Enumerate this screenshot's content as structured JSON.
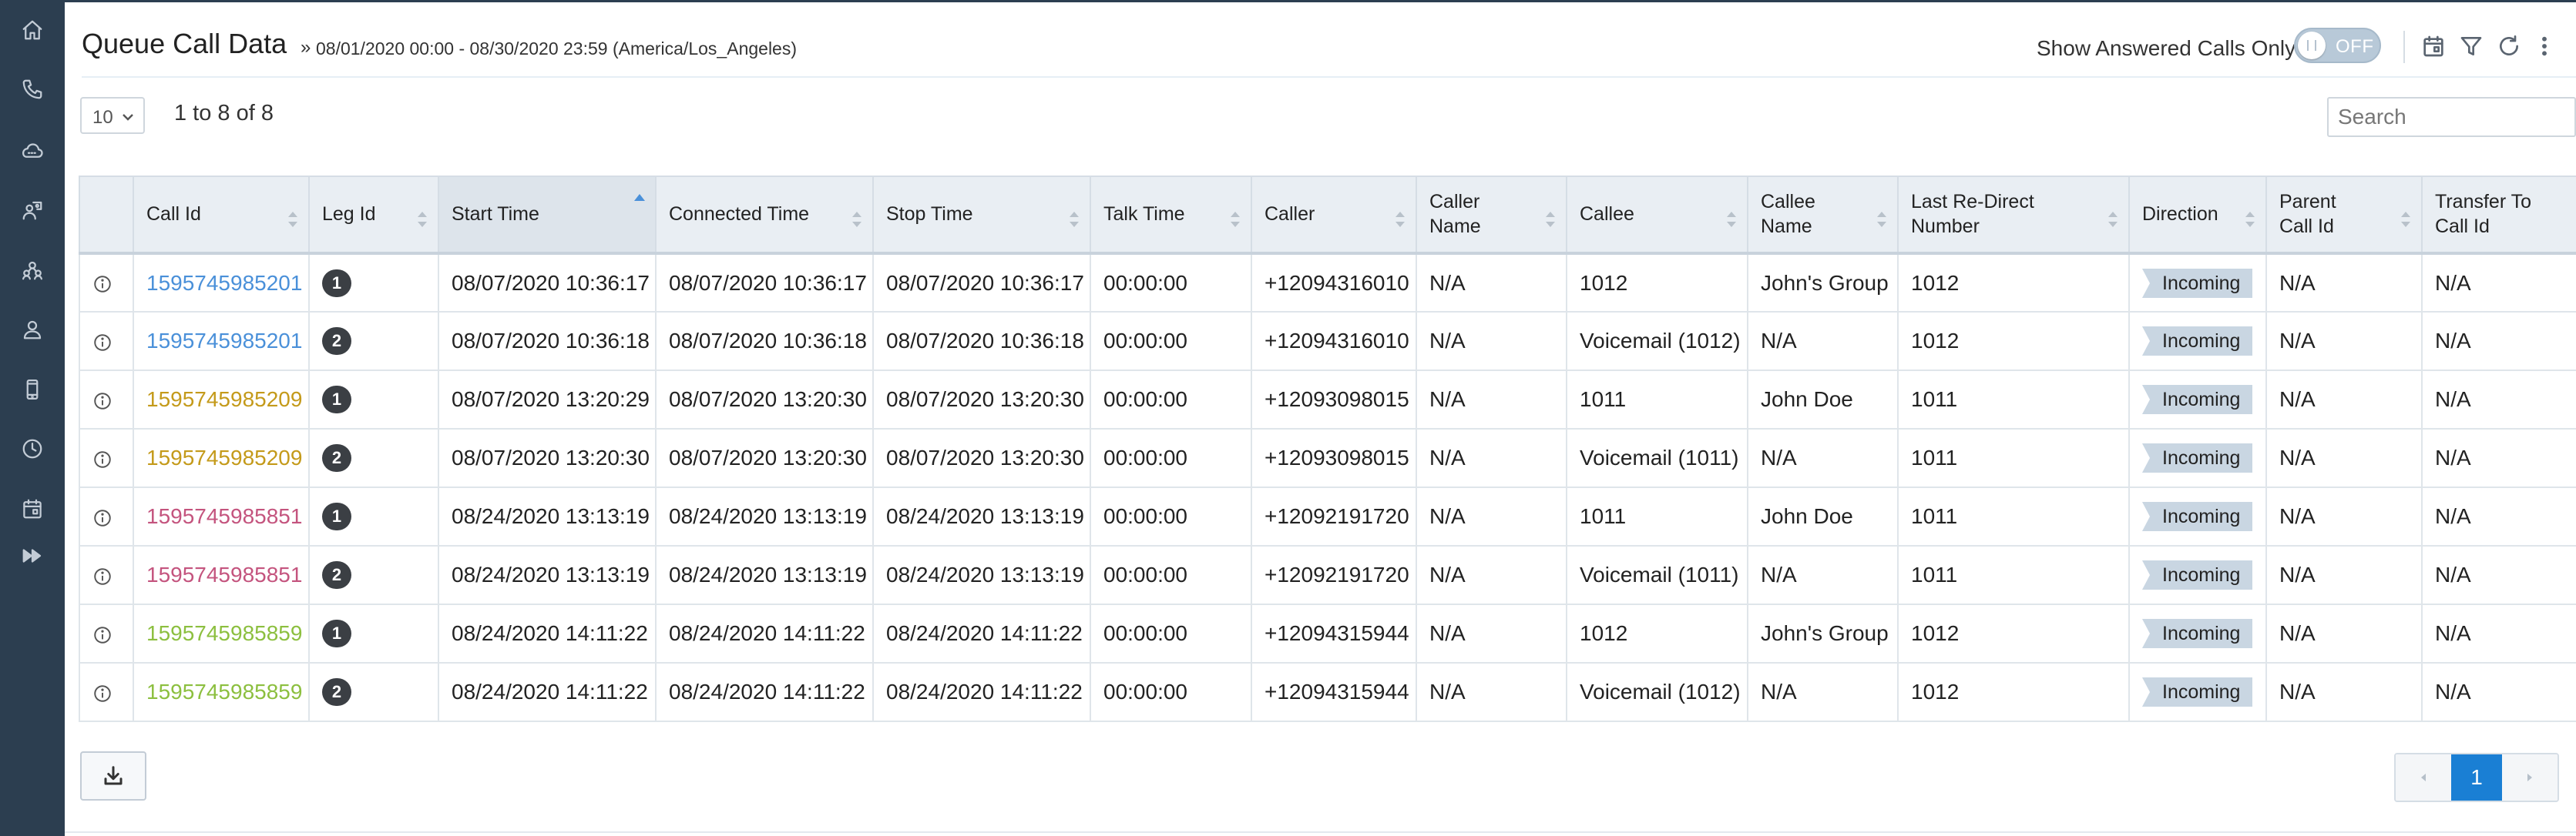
{
  "header": {
    "title": "Queue Call Data",
    "separator": "»",
    "date_range": "08/01/2020 00:00 - 08/30/2020 23:59 (America/Los_Angeles)",
    "answered_label": "Show Answered Calls Only",
    "answered_toggle": "OFF"
  },
  "sidebar": {
    "icons": [
      "home-icon",
      "phone-icon",
      "cloud-icon",
      "users-icon",
      "group-icon",
      "user-icon",
      "mobile-icon",
      "clock-icon",
      "calendar-icon",
      "fast-forward-icon"
    ]
  },
  "controls": {
    "page_size": "10",
    "count_text": "1 to 8 of 8",
    "search_placeholder": "Search"
  },
  "table": {
    "columns": {
      "call_id": "Call Id",
      "leg_id": "Leg Id",
      "start_time": "Start Time",
      "connected_time": "Connected Time",
      "stop_time": "Stop Time",
      "talk_time": "Talk Time",
      "caller": "Caller",
      "caller_name": "Caller Name",
      "callee": "Callee",
      "callee_name": "Callee Name",
      "last_redirect": "Last Re-Direct Number",
      "direction": "Direction",
      "parent_call_id": "Parent Call Id",
      "transfer_to": "Transfer To Call Id"
    },
    "sorted_column": "start_time",
    "rows": [
      {
        "call_id": "1595745985201",
        "call_color": "#4a90d9",
        "leg": "1",
        "start": "08/07/2020 10:36:17",
        "connected": "08/07/2020 10:36:17",
        "stop": "08/07/2020 10:36:17",
        "talk": "00:00:00",
        "caller": "+12094316010",
        "caller_name": "N/A",
        "callee": "1012",
        "callee_name": "John's Group",
        "redirect": "1012",
        "direction": "Incoming",
        "parent": "N/A",
        "transfer": "N/A"
      },
      {
        "call_id": "1595745985201",
        "call_color": "#4a90d9",
        "leg": "2",
        "start": "08/07/2020 10:36:18",
        "connected": "08/07/2020 10:36:18",
        "stop": "08/07/2020 10:36:18",
        "talk": "00:00:00",
        "caller": "+12094316010",
        "caller_name": "N/A",
        "callee": "Voicemail (1012)",
        "callee_name": "N/A",
        "redirect": "1012",
        "direction": "Incoming",
        "parent": "N/A",
        "transfer": "N/A"
      },
      {
        "call_id": "1595745985209",
        "call_color": "#c49a1a",
        "leg": "1",
        "start": "08/07/2020 13:20:29",
        "connected": "08/07/2020 13:20:30",
        "stop": "08/07/2020 13:20:30",
        "talk": "00:00:00",
        "caller": "+12093098015",
        "caller_name": "N/A",
        "callee": "1011",
        "callee_name": "John Doe",
        "redirect": "1011",
        "direction": "Incoming",
        "parent": "N/A",
        "transfer": "N/A"
      },
      {
        "call_id": "1595745985209",
        "call_color": "#c49a1a",
        "leg": "2",
        "start": "08/07/2020 13:20:30",
        "connected": "08/07/2020 13:20:30",
        "stop": "08/07/2020 13:20:30",
        "talk": "00:00:00",
        "caller": "+12093098015",
        "caller_name": "N/A",
        "callee": "Voicemail (1011)",
        "callee_name": "N/A",
        "redirect": "1011",
        "direction": "Incoming",
        "parent": "N/A",
        "transfer": "N/A"
      },
      {
        "call_id": "1595745985851",
        "call_color": "#c4547e",
        "leg": "1",
        "start": "08/24/2020 13:13:19",
        "connected": "08/24/2020 13:13:19",
        "stop": "08/24/2020 13:13:19",
        "talk": "00:00:00",
        "caller": "+12092191720",
        "caller_name": "N/A",
        "callee": "1011",
        "callee_name": "John Doe",
        "redirect": "1011",
        "direction": "Incoming",
        "parent": "N/A",
        "transfer": "N/A"
      },
      {
        "call_id": "1595745985851",
        "call_color": "#c4547e",
        "leg": "2",
        "start": "08/24/2020 13:13:19",
        "connected": "08/24/2020 13:13:19",
        "stop": "08/24/2020 13:13:19",
        "talk": "00:00:00",
        "caller": "+12092191720",
        "caller_name": "N/A",
        "callee": "Voicemail (1011)",
        "callee_name": "N/A",
        "redirect": "1011",
        "direction": "Incoming",
        "parent": "N/A",
        "transfer": "N/A"
      },
      {
        "call_id": "1595745985859",
        "call_color": "#8cbf3f",
        "leg": "1",
        "start": "08/24/2020 14:11:22",
        "connected": "08/24/2020 14:11:22",
        "stop": "08/24/2020 14:11:22",
        "talk": "00:00:00",
        "caller": "+12094315944",
        "caller_name": "N/A",
        "callee": "1012",
        "callee_name": "John's Group",
        "redirect": "1012",
        "direction": "Incoming",
        "parent": "N/A",
        "transfer": "N/A"
      },
      {
        "call_id": "1595745985859",
        "call_color": "#8cbf3f",
        "leg": "2",
        "start": "08/24/2020 14:11:22",
        "connected": "08/24/2020 14:11:22",
        "stop": "08/24/2020 14:11:22",
        "talk": "00:00:00",
        "caller": "+12094315944",
        "caller_name": "N/A",
        "callee": "Voicemail (1012)",
        "callee_name": "N/A",
        "redirect": "1012",
        "direction": "Incoming",
        "parent": "N/A",
        "transfer": "N/A"
      }
    ]
  },
  "footer": {
    "download_icon": "download-icon",
    "current_page": "1"
  },
  "colors": {
    "sidebar_bg": "#2c3e50",
    "header_bg": "#e9eef3",
    "pager_active": "#1a7fd4",
    "direction_tag": "#c9d6e2"
  }
}
